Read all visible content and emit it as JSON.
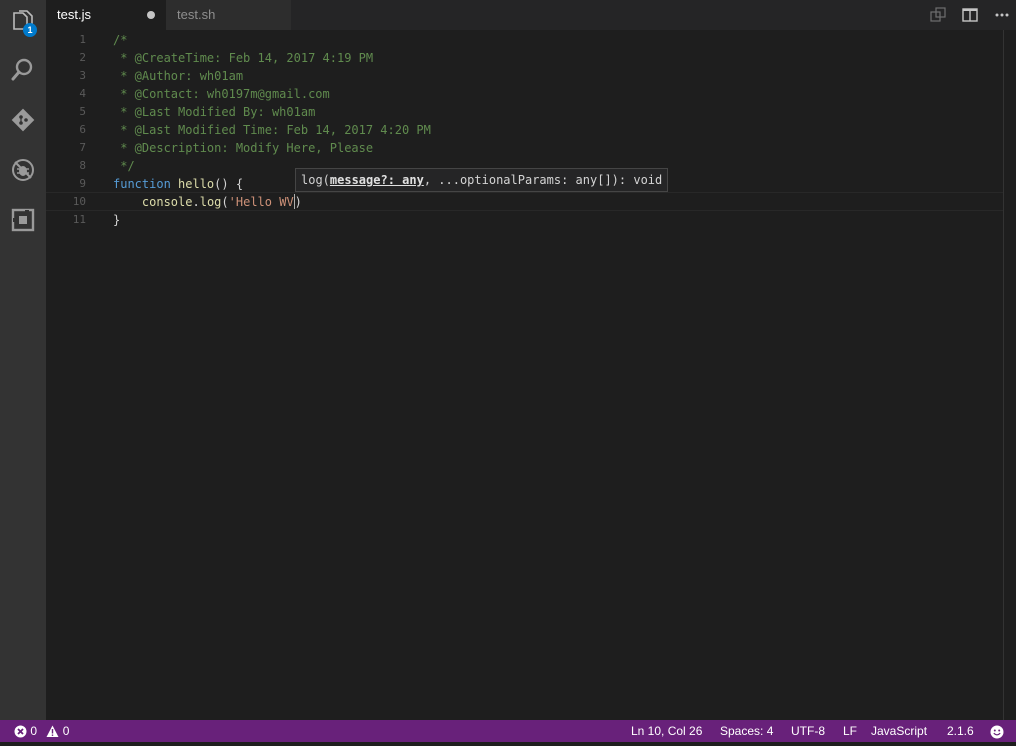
{
  "activity": {
    "explorer_badge": "1",
    "icons": [
      "files-icon",
      "search-icon",
      "git-icon",
      "debug-icon",
      "extensions-icon"
    ]
  },
  "tabs": [
    {
      "label": "test.js",
      "active": true,
      "dirty": true
    },
    {
      "label": "test.sh",
      "active": false
    }
  ],
  "editor": {
    "line_numbers": [
      "1",
      "2",
      "3",
      "4",
      "5",
      "6",
      "7",
      "8",
      "9",
      "10",
      "11"
    ],
    "lines": [
      {
        "segments": [
          {
            "text": "/*",
            "kind": "comment"
          }
        ]
      },
      {
        "segments": [
          {
            "text": " * @CreateTime: Feb 14, 2017 4:19 PM",
            "kind": "comment"
          }
        ]
      },
      {
        "segments": [
          {
            "text": " * @Author: wh01am",
            "kind": "comment"
          }
        ]
      },
      {
        "segments": [
          {
            "text": " * @Contact: wh0197m@gmail.com",
            "kind": "comment"
          }
        ]
      },
      {
        "segments": [
          {
            "text": " * @Last Modified By: wh01am",
            "kind": "comment"
          }
        ]
      },
      {
        "segments": [
          {
            "text": " * @Last Modified Time: Feb 14, 2017 4:20 PM",
            "kind": "comment"
          }
        ]
      },
      {
        "segments": [
          {
            "text": " * @Description: Modify Here, Please",
            "kind": "comment"
          }
        ]
      },
      {
        "segments": [
          {
            "text": " */",
            "kind": "comment"
          }
        ]
      },
      {
        "segments": [
          {
            "text": "function",
            "kind": "kw"
          },
          {
            "text": " ",
            "kind": "punc"
          },
          {
            "text": "hello",
            "kind": "fn"
          },
          {
            "text": "() {",
            "kind": "punc"
          }
        ]
      },
      {
        "segments": [
          {
            "text": "    ",
            "kind": "punc"
          },
          {
            "text": "console",
            "kind": "fn"
          },
          {
            "text": ".",
            "kind": "punc"
          },
          {
            "text": "log",
            "kind": "fn"
          },
          {
            "text": "(",
            "kind": "punc"
          },
          {
            "text": "'Hello WV",
            "kind": "str"
          },
          {
            "text": "|",
            "kind": "cursor"
          },
          {
            "text": ")",
            "kind": "punc"
          }
        ]
      },
      {
        "segments": [
          {
            "text": "}",
            "kind": "punc"
          }
        ]
      }
    ],
    "hover": {
      "prefix": "log(",
      "param": "message?: any",
      "suffix": ", ...optionalParams: any[]): void"
    }
  },
  "status": {
    "errors": "0",
    "warnings": "0",
    "position": "Ln 10, Col 26",
    "spaces": "Spaces: 4",
    "encoding": "UTF-8",
    "eol": "LF",
    "language": "JavaScript",
    "version": "2.1.6"
  },
  "colors": {
    "status_bar": "#68217a",
    "accent": "#007acc"
  }
}
